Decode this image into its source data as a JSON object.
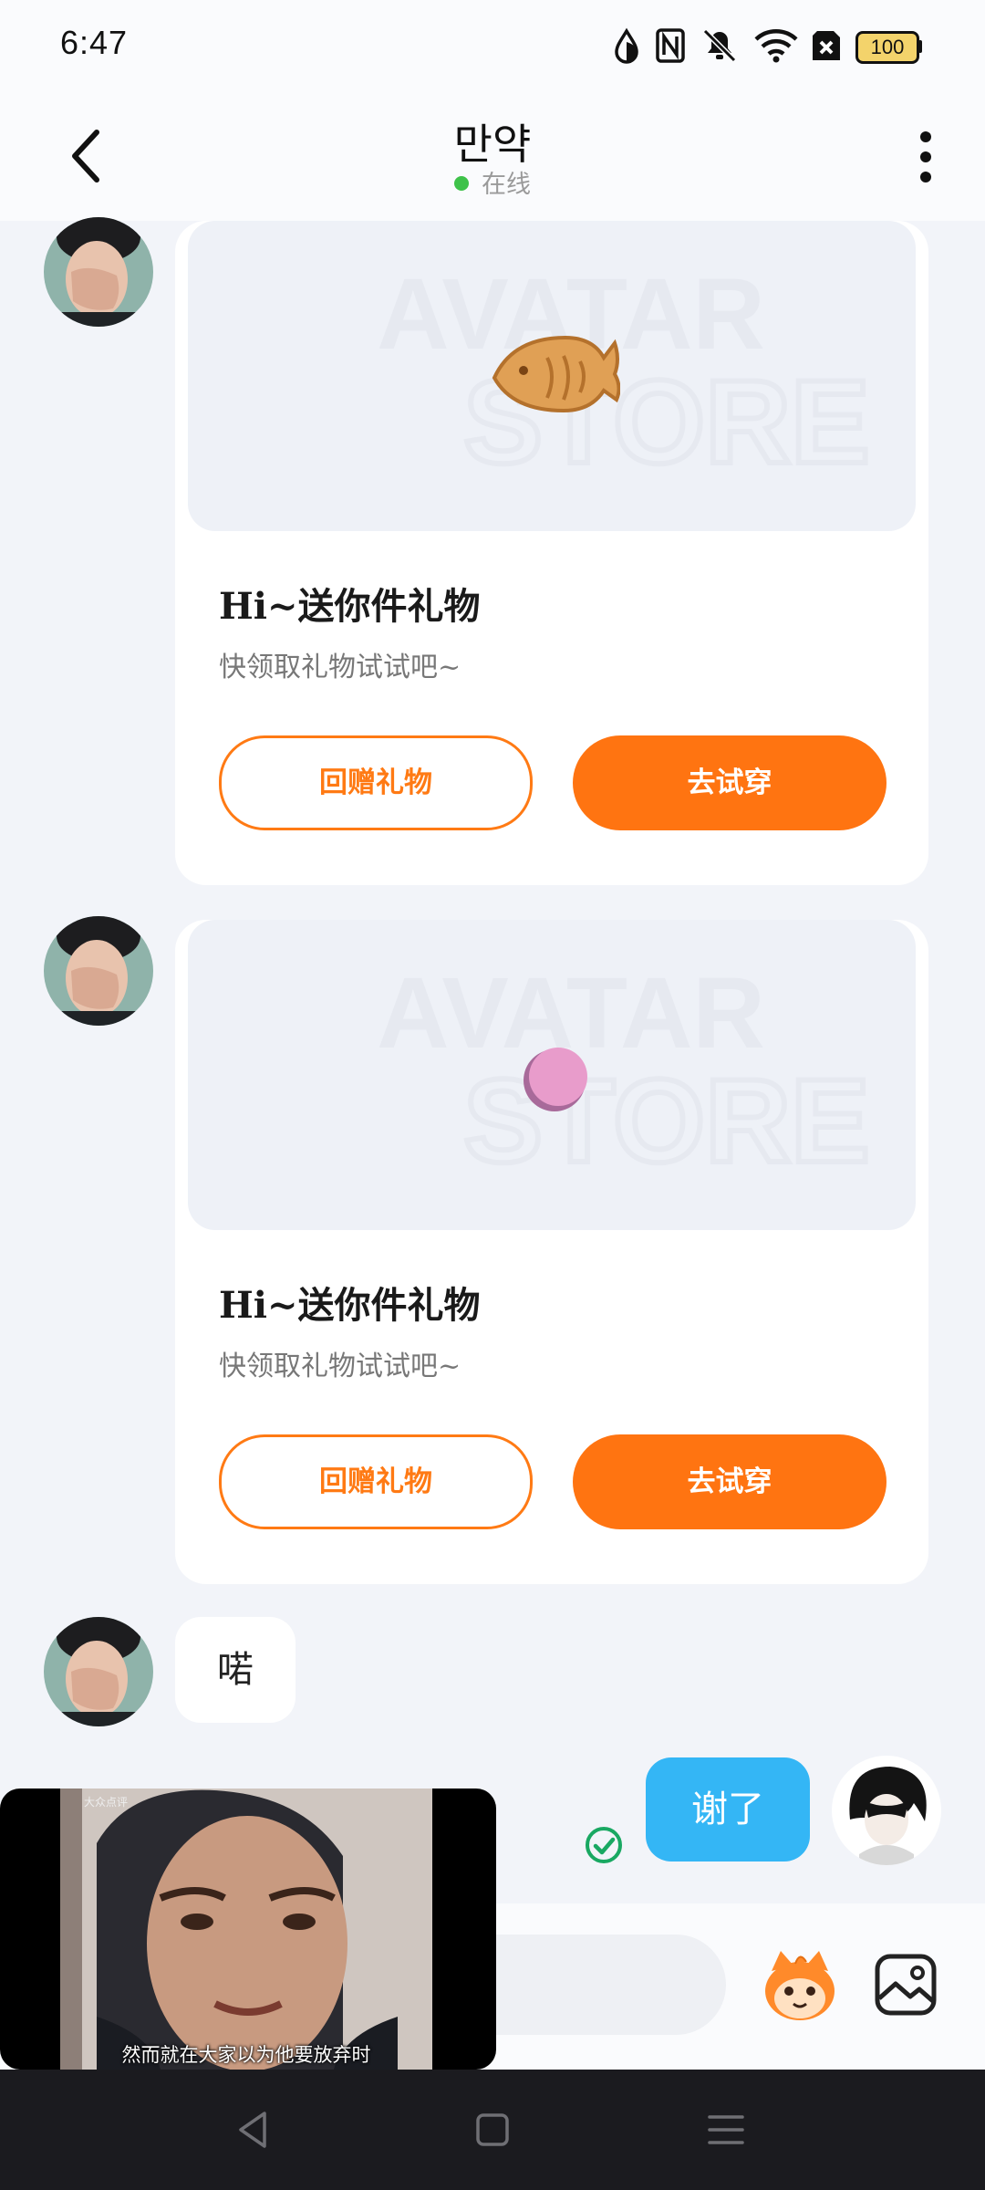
{
  "status_bar": {
    "time": "6:47",
    "battery": "100",
    "icons": [
      "data-saver-icon",
      "nfc-icon",
      "mute-vibrate-icon",
      "wifi-icon",
      "no-sim-icon",
      "battery-icon"
    ]
  },
  "header": {
    "title": "만약",
    "status": "在线",
    "status_color": "#3ec24a",
    "back_icon": "chevron-left-icon",
    "more_icon": "more-vertical-icon"
  },
  "messages": [
    {
      "type": "gift",
      "from": "them",
      "watermark_line1": "AVATAR",
      "watermark_line2": "STORE",
      "gift_icon": "fish-cracker-icon",
      "title": "Hi~送你件礼物",
      "subtitle": "快领取礼物试试吧~",
      "secondary_button": "回赠礼物",
      "primary_button": "去试穿"
    },
    {
      "type": "gift",
      "from": "them",
      "watermark_line1": "AVATAR",
      "watermark_line2": "STORE",
      "gift_icon": "pink-ball-icon",
      "title": "Hi~送你件礼物",
      "subtitle": "快领取礼物试试吧~",
      "secondary_button": "回赠礼物",
      "primary_button": "去试穿"
    },
    {
      "type": "text",
      "from": "them",
      "text": "喏"
    },
    {
      "type": "text",
      "from": "me",
      "text": "谢了",
      "read": true
    }
  ],
  "pip_video": {
    "caption": "然而就在大家以为他要放弃时",
    "tag": "大众点评"
  },
  "input_bar": {
    "placeholder": "",
    "mascot_icon": "mascot-sticker-icon",
    "image_icon": "image-icon"
  },
  "nav_bar": {
    "icons": [
      "back-triangle-icon",
      "home-square-icon",
      "recents-menu-icon"
    ]
  },
  "colors": {
    "accent_orange": "#ff7411",
    "outgoing_bubble": "#34b6f5",
    "background": "#f2f4f9"
  }
}
